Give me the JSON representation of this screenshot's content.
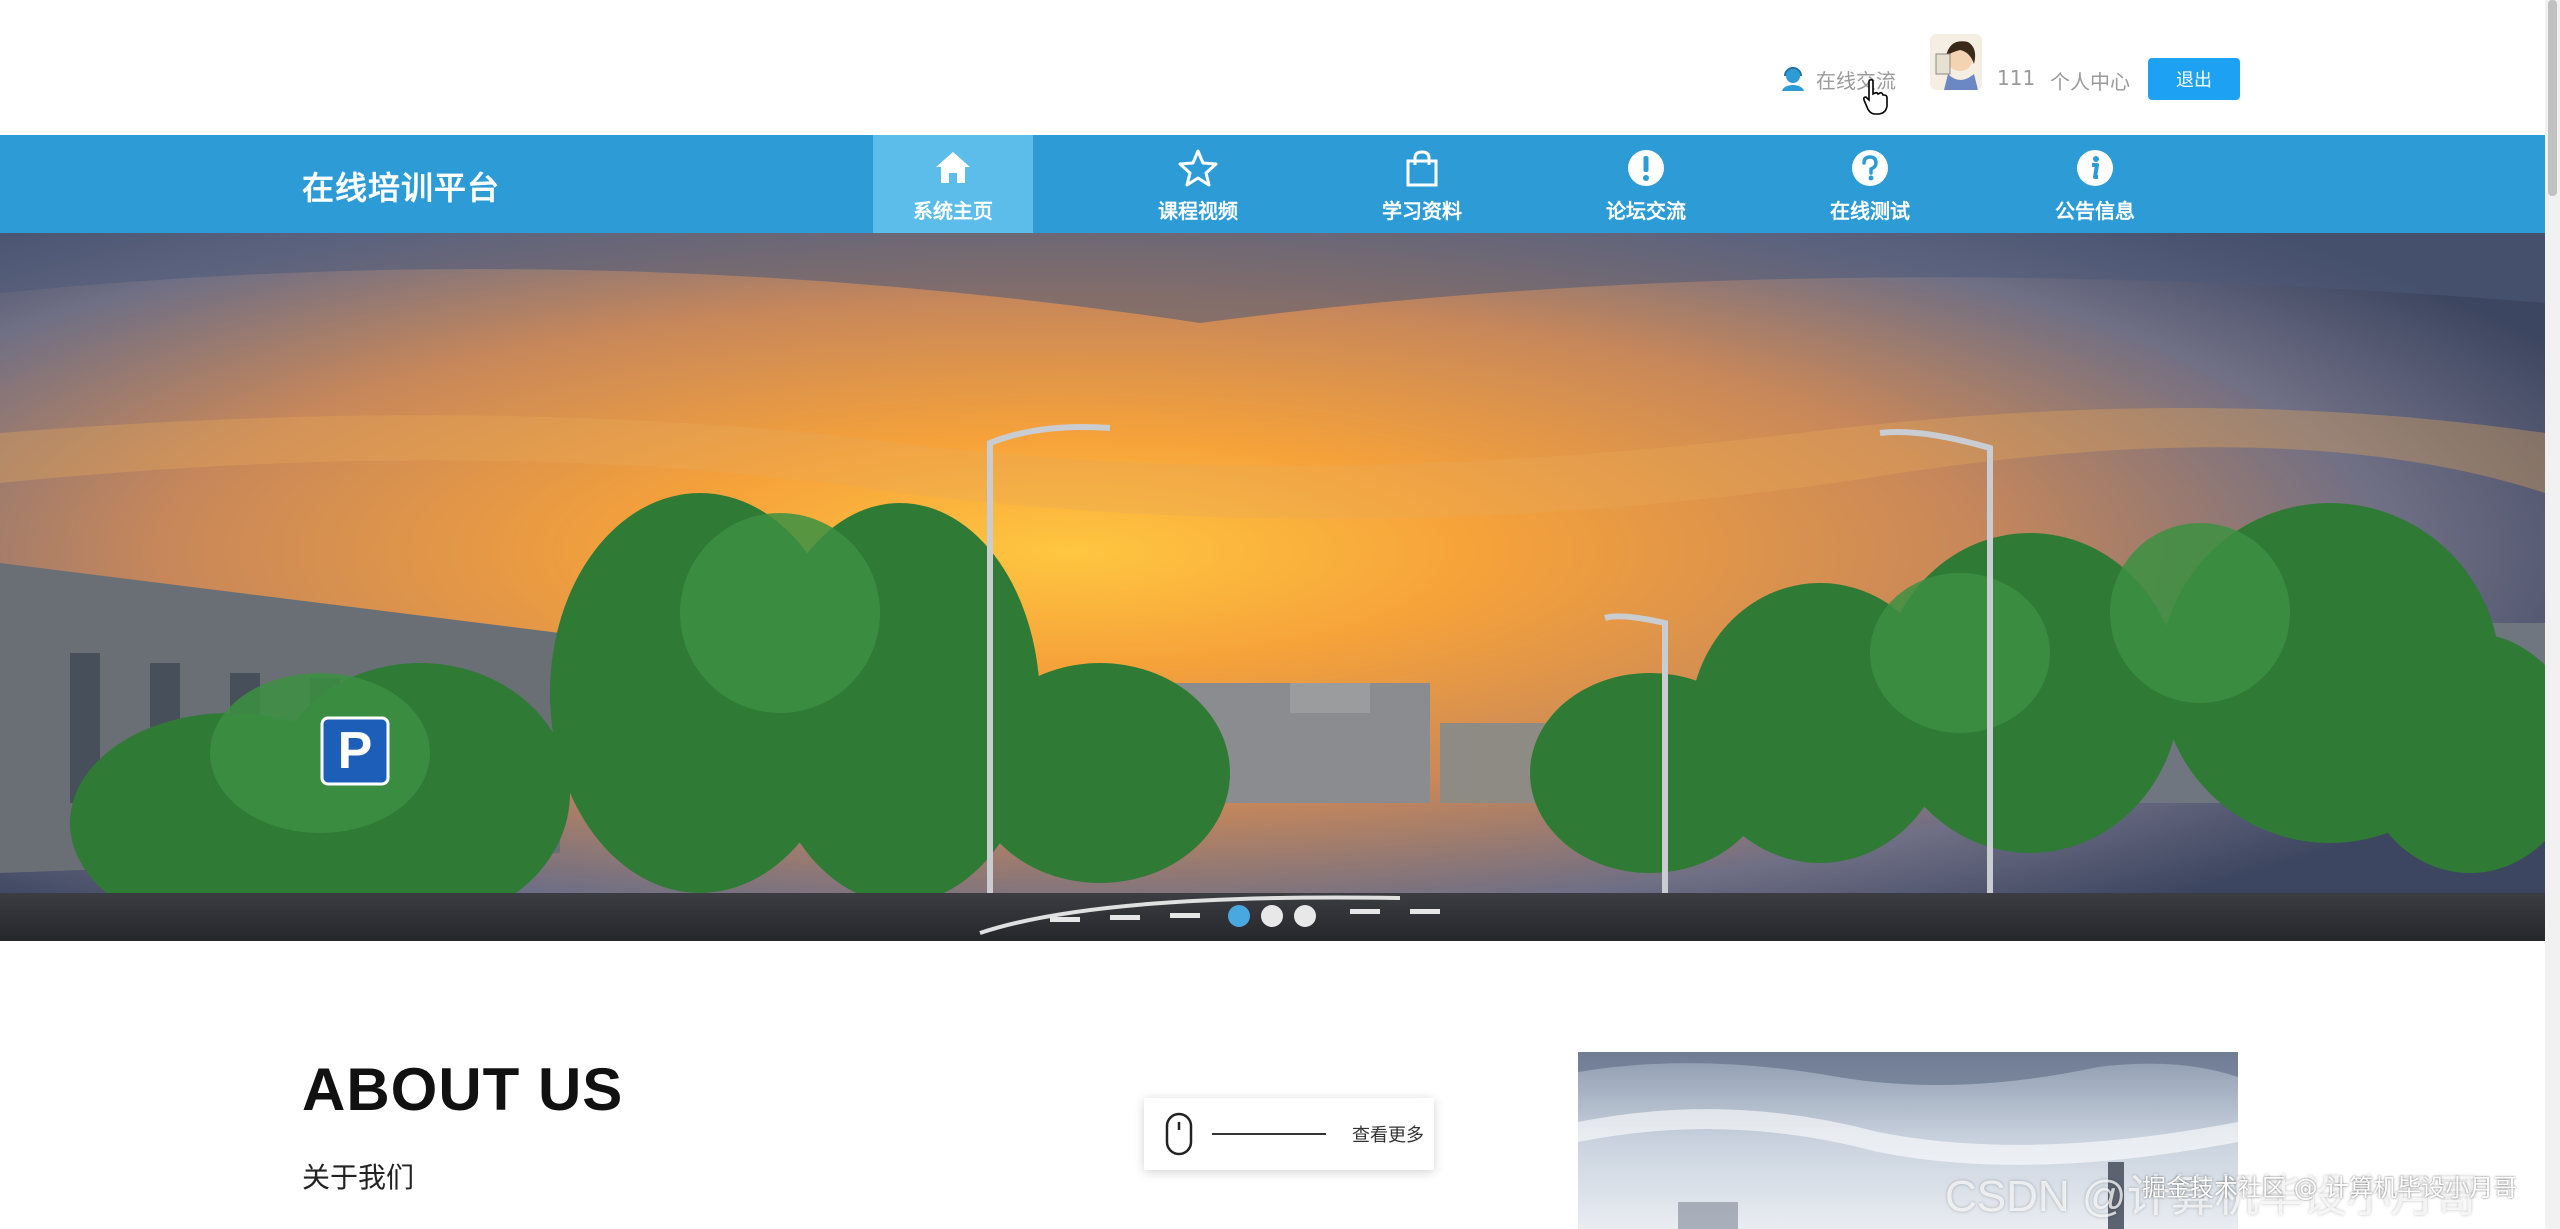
{
  "topbar": {
    "chat_label": "在线交流",
    "username": "111",
    "center_label": "个人中心",
    "logout_label": "退出"
  },
  "nav": {
    "brand": "在线培训平台",
    "items": [
      {
        "label": "系统主页",
        "icon": "home-icon"
      },
      {
        "label": "课程视频",
        "icon": "star-icon"
      },
      {
        "label": "学习资料",
        "icon": "shopping-bag-icon"
      },
      {
        "label": "论坛交流",
        "icon": "exclamation-icon"
      },
      {
        "label": "在线测试",
        "icon": "question-icon"
      },
      {
        "label": "公告信息",
        "icon": "info-icon"
      }
    ],
    "active_index": 0
  },
  "banner": {
    "slide_count": 3,
    "active_slide": 0
  },
  "about": {
    "title": "ABOUT US",
    "subtitle": "关于我们",
    "more_label": "查看更多"
  },
  "watermark": {
    "csdn": "CSDN @计算机毕设小月哥",
    "juejin": "掘金技术社区 @ 计算机毕设小月哥"
  },
  "colors": {
    "nav_bg": "#2d9bd6",
    "nav_active": "#5cbdea",
    "logout_bg": "#1da1f2",
    "dot_active": "#4aa8e0"
  }
}
